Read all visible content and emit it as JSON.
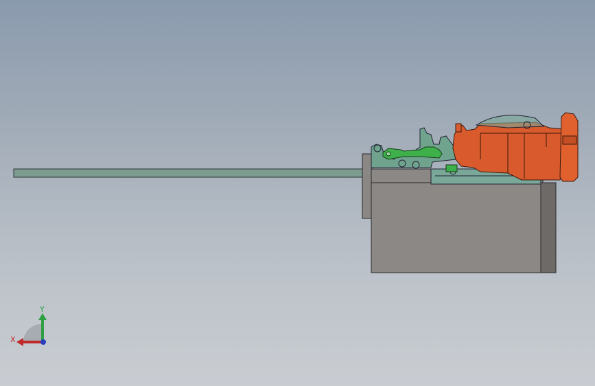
{
  "colors": {
    "background_top": "#8a9aad",
    "background_bottom": "#c9cdd2",
    "rod": "#7c9c90",
    "base_block": "#8c8886",
    "carriage": "#d95a2c",
    "mechanism": "#6fa38e",
    "green_part": "#3db04a",
    "x_axis": "#c0282a",
    "y_axis": "#2ea043",
    "z_axis": "#2a3fc0"
  },
  "triad": {
    "x_label": "X",
    "y_label": "Y"
  }
}
